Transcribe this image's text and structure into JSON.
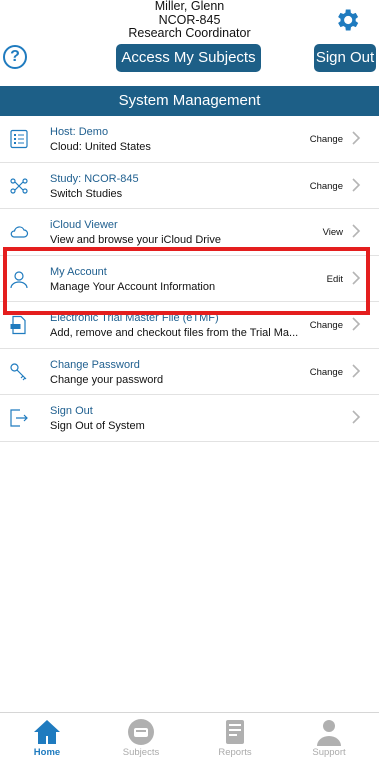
{
  "user": {
    "name": "Miller, Glenn",
    "study": "NCOR-845",
    "role": "Research Coordinator"
  },
  "header": {
    "help_symbol": "?",
    "access_button": "Access My Subjects",
    "signout_button": "Sign Out"
  },
  "section": {
    "title": "System Management"
  },
  "menu": {
    "items": [
      {
        "title": "Host: Demo",
        "subtitle": "Cloud: United States",
        "action": "Change",
        "icon": "host-list-icon"
      },
      {
        "title": "Study: NCOR-845",
        "subtitle": "Switch Studies",
        "action": "Change",
        "icon": "switch-study-icon"
      },
      {
        "title": "iCloud Viewer",
        "subtitle": "View and browse your iCloud Drive",
        "action": "View",
        "icon": "cloud-icon"
      },
      {
        "title": "My Account",
        "subtitle": "Manage Your Account Information",
        "action": "Edit",
        "icon": "user-icon"
      },
      {
        "title": "Electronic Trial Master File (eTMF)",
        "subtitle": "Add, remove and checkout files from the Trial Ma...",
        "action": "Change",
        "icon": "etmf-file-icon"
      },
      {
        "title": "Change Password",
        "subtitle": "Change your password",
        "action": "Change",
        "icon": "key-icon"
      },
      {
        "title": "Sign Out",
        "subtitle": "Sign Out of System",
        "action": "",
        "icon": "sign-out-icon"
      }
    ]
  },
  "tabs": [
    {
      "label": "Home",
      "icon": "home-icon",
      "active": true
    },
    {
      "label": "Subjects",
      "icon": "subjects-icon",
      "active": false
    },
    {
      "label": "Reports",
      "icon": "reports-icon",
      "active": false
    },
    {
      "label": "Support",
      "icon": "support-icon",
      "active": false
    }
  ],
  "colors": {
    "brand": "#1d5f87",
    "accent": "#1f7bbf",
    "highlight": "#e41e1e"
  }
}
